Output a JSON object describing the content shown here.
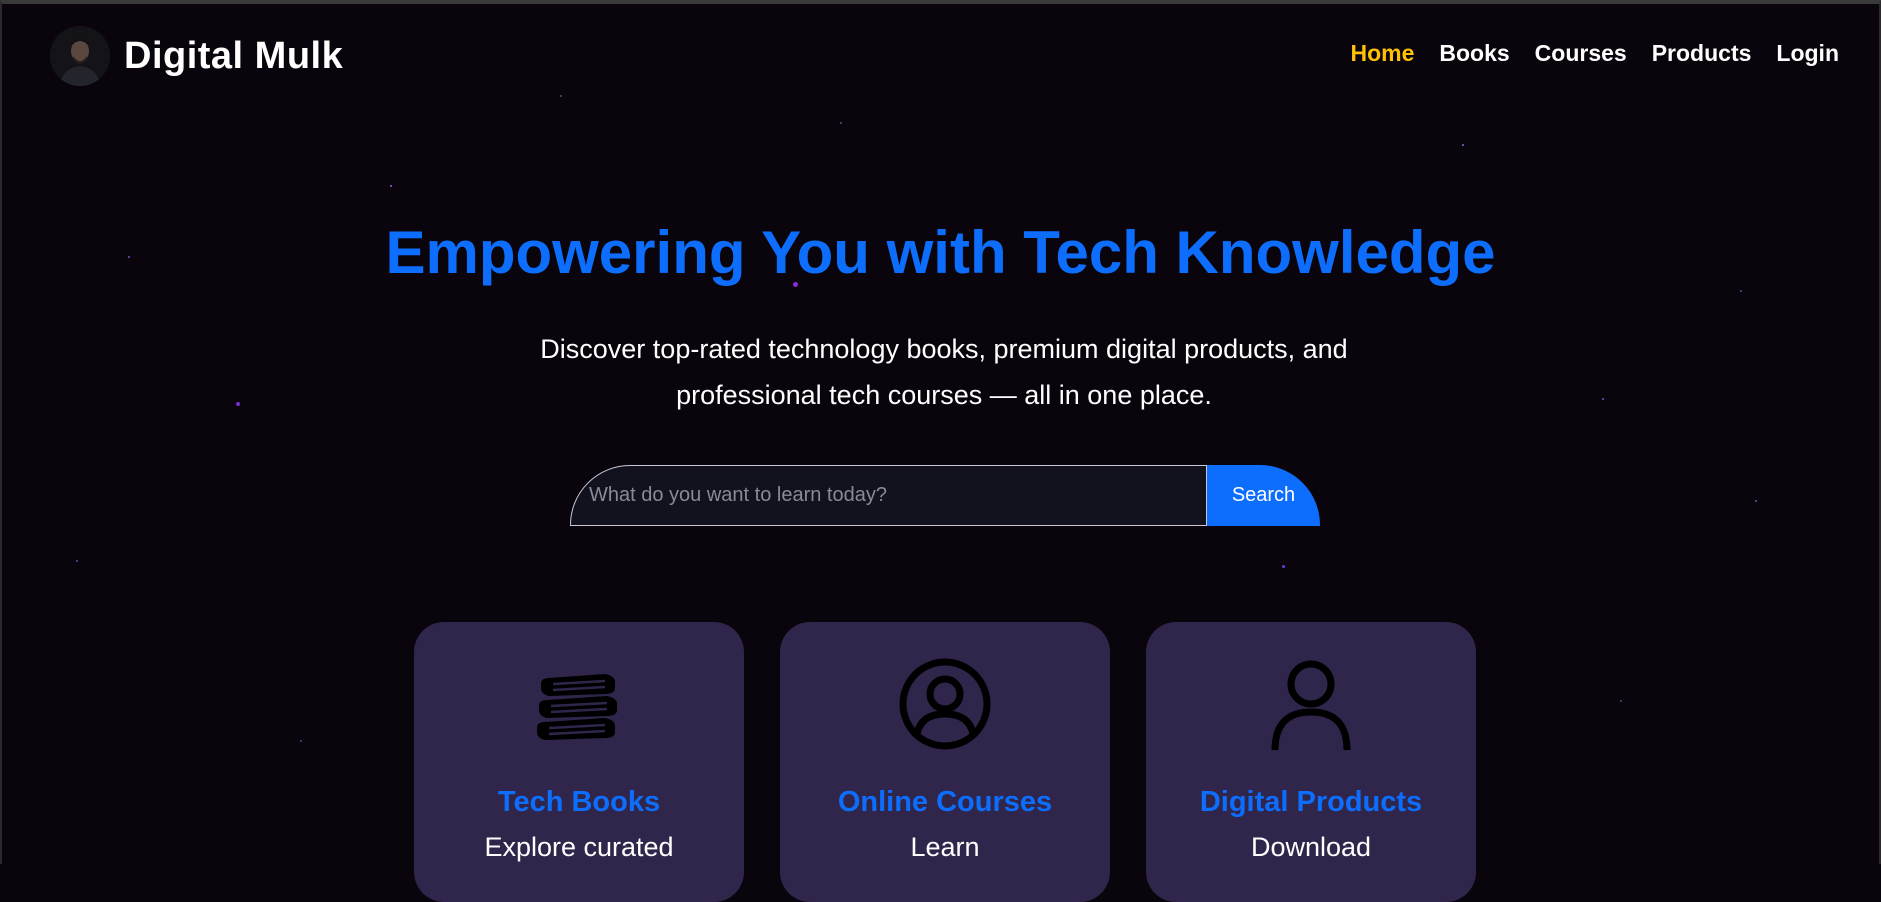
{
  "brand": {
    "name": "Digital Mulk"
  },
  "nav": {
    "items": [
      {
        "label": "Home",
        "active": true
      },
      {
        "label": "Books",
        "active": false
      },
      {
        "label": "Courses",
        "active": false
      },
      {
        "label": "Products",
        "active": false
      },
      {
        "label": "Login",
        "active": false
      }
    ]
  },
  "hero": {
    "title": "Empowering You with Tech Knowledge",
    "subtitle": "Discover top-rated technology books, premium digital products, and professional tech courses — all in one place."
  },
  "search": {
    "placeholder": "What do you want to learn today?",
    "value": "",
    "button_label": "Search"
  },
  "cards": [
    {
      "icon": "books-icon",
      "title": "Tech Books",
      "description": "Explore curated"
    },
    {
      "icon": "user-circle-icon",
      "title": "Online Courses",
      "description": "Learn"
    },
    {
      "icon": "person-icon",
      "title": "Digital Products",
      "description": "Download"
    }
  ],
  "colors": {
    "background": "#0a040c",
    "accent": "#0d6efd",
    "active_nav": "#ffc107",
    "card": "#30254a"
  }
}
